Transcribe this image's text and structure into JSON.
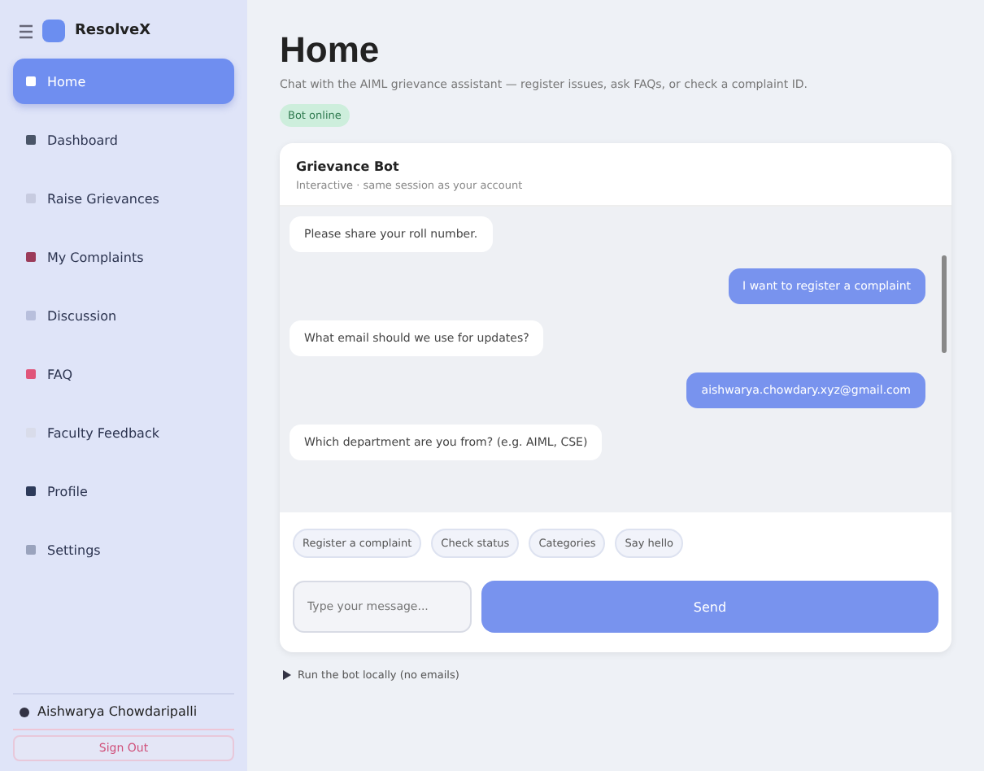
{
  "sidebar": {
    "brand": "ResolveX",
    "items": [
      {
        "label": "Home",
        "selected": true,
        "color": "#ffffff"
      },
      {
        "label": "Dashboard",
        "selected": false,
        "color": "#4a5568"
      },
      {
        "label": "Raise Grievances",
        "selected": false,
        "color": "#c7cbe0"
      },
      {
        "label": "My Complaints",
        "selected": false,
        "color": "#9b3b5a"
      },
      {
        "label": "Discussion",
        "selected": false,
        "color": "#b8bfdc"
      },
      {
        "label": "FAQ",
        "selected": false,
        "color": "#e0557a"
      },
      {
        "label": "Faculty Feedback",
        "selected": false,
        "color": "#d9dcea"
      },
      {
        "label": "Profile",
        "selected": false,
        "color": "#2d3a5a"
      },
      {
        "label": "Settings",
        "selected": false,
        "color": "#9aa3bd"
      }
    ],
    "user": "Aishwarya Chowdaripalli",
    "sign_out": "Sign Out"
  },
  "page": {
    "title": "Home",
    "subtitle": "Chat with the AIML grievance assistant — register issues, ask FAQs, or check a complaint ID.",
    "status_badge": "Bot online"
  },
  "chat": {
    "title": "Grievance Bot",
    "subtitle": "Interactive · same session as your account",
    "messages": [
      {
        "kind": "bot",
        "text": "Please share your roll number."
      },
      {
        "kind": "user",
        "text": "I want to register a complaint"
      },
      {
        "kind": "bot",
        "text": "What email should we use for updates?"
      },
      {
        "kind": "user",
        "text": "aishwarya.chowdary.xyz@gmail.com"
      },
      {
        "kind": "bot",
        "text": "Which department are you from? (e.g. AIML, CSE)"
      }
    ],
    "quick_replies": [
      "Register a complaint",
      "Check status",
      "Categories",
      "Say hello"
    ],
    "input": {
      "placeholder": "Type your message..."
    },
    "send": "Send"
  },
  "footer": {
    "toggle": "Run the bot locally (no emails)",
    "expanded": false
  }
}
